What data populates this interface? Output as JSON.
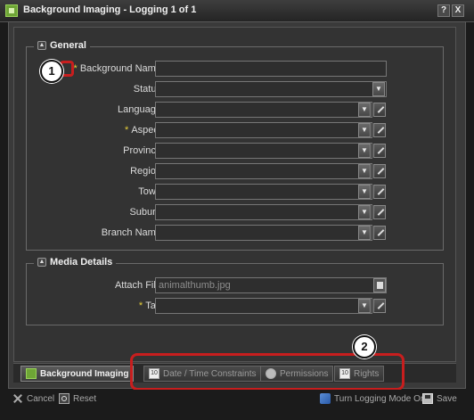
{
  "window": {
    "title": "Background Imaging - Logging 1 of 1",
    "help_label": "?",
    "close_label": "X"
  },
  "general": {
    "legend": "General",
    "fields": [
      {
        "label": "Background Name:",
        "required": true
      },
      {
        "label": "Status:",
        "required": false
      },
      {
        "label": "Language:",
        "required": false
      },
      {
        "label": "Aspect:",
        "required": true
      },
      {
        "label": "Province:",
        "required": false
      },
      {
        "label": "Region:",
        "required": false
      },
      {
        "label": "Town:",
        "required": false
      },
      {
        "label": "Suburb:",
        "required": false
      },
      {
        "label": "Branch Name:",
        "required": false
      }
    ]
  },
  "media": {
    "legend": "Media Details",
    "attach_label": "Attach File:",
    "attach_value": "animalthumb.jpg",
    "tag_label": "Tag:"
  },
  "required_marker": "*",
  "tabs": [
    {
      "label": "Background Imaging",
      "active": true
    },
    {
      "label": "Date / Time Constraints",
      "active": false
    },
    {
      "label": "Permissions",
      "active": false
    },
    {
      "label": "Rights",
      "active": false
    }
  ],
  "footer": {
    "cancel": "Cancel",
    "reset": "Reset",
    "logging_mode": "Turn Logging Mode On",
    "save": "Save"
  },
  "callouts": [
    "1",
    "2"
  ],
  "colors": {
    "required": "#e6cf3a",
    "highlight": "#c81e1e"
  }
}
